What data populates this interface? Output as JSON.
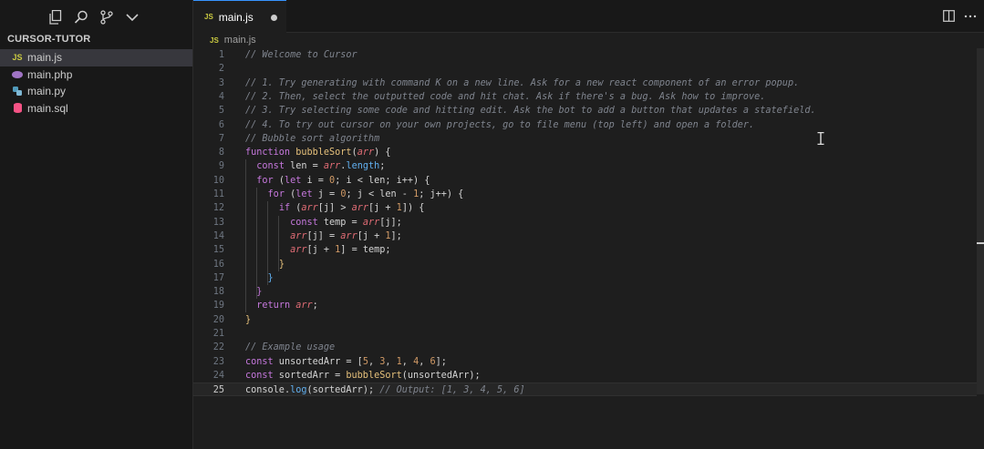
{
  "sidebar": {
    "title": "CURSOR-TUTOR",
    "files": [
      {
        "name": "main.js",
        "badge": "JS",
        "color": "#cbcb41"
      },
      {
        "name": "main.php",
        "badge": "php",
        "color": "#a074c4"
      },
      {
        "name": "main.py",
        "badge": "py",
        "color": "#519aba"
      },
      {
        "name": "main.sql",
        "badge": "sql",
        "color": "#f55385"
      }
    ],
    "icons": [
      "files-icon",
      "search-icon",
      "source-control-icon",
      "chevron-down-icon"
    ]
  },
  "tab": {
    "label": "main.js",
    "badge": "JS",
    "modified": true
  },
  "breadcrumb": {
    "badge": "JS",
    "label": "main.js"
  },
  "editor": {
    "current_line": 25,
    "lines": [
      {
        "n": "1"
      },
      {
        "n": "2"
      },
      {
        "n": "3"
      },
      {
        "n": "4"
      },
      {
        "n": "5"
      },
      {
        "n": "6"
      },
      {
        "n": "7"
      },
      {
        "n": "8"
      },
      {
        "n": "9"
      },
      {
        "n": "10"
      },
      {
        "n": "11"
      },
      {
        "n": "12"
      },
      {
        "n": "13"
      },
      {
        "n": "14"
      },
      {
        "n": "15"
      },
      {
        "n": "16"
      },
      {
        "n": "17"
      },
      {
        "n": "18"
      },
      {
        "n": "19"
      },
      {
        "n": "20"
      },
      {
        "n": "21"
      },
      {
        "n": "22"
      },
      {
        "n": "23"
      },
      {
        "n": "24"
      },
      {
        "n": "25"
      }
    ],
    "tokens": {
      "l1": "// Welcome to Cursor",
      "l3": "// 1. Try generating with command K on a new line. Ask for a new react component of an error popup.",
      "l4": "// 2. Then, select the outputted code and hit chat. Ask if there's a bug. Ask how to improve.",
      "l5": "// 3. Try selecting some code and hitting edit. Ask the bot to add a button that updates a statefield.",
      "l6": "// 4. To try out cursor on your own projects, go to file menu (top left) and open a folder.",
      "l7": "// Bubble sort algorithm",
      "function": "function",
      "bubbleSort": "bubbleSort",
      "arr": "arr",
      "const": "const",
      "for": "for",
      "let": "let",
      "if": "if",
      "return": "return",
      "length": "length",
      "console": "console",
      "log": "log",
      "l8_rest": ") {",
      "l9_a": " len = ",
      "l9_b": ";",
      "l10_a": " (",
      "l10_b": " i = ",
      "l10_c": "0",
      "l10_d": "; i < len; i++) {",
      "l11_b": " j = ",
      "l11_d": "; j < len - ",
      "l11_e": "1",
      "l11_f": "; j++) {",
      "l12_a": " (",
      "l12_b": "[j] > ",
      "l12_c": "[j + ",
      "l12_d": "]) {",
      "l13_a": " temp = ",
      "l13_b": "[j];",
      "l14_a": "[j] = ",
      "l14_b": "[j + ",
      "l14_c": "];",
      "l15_a": "[j + ",
      "l15_b": "] = temp;",
      "brace_close": "}",
      "l19_a": " ",
      "l19_b": ";",
      "l22": "// Example usage",
      "l23_a": " unsortedArr = [",
      "n5": "5",
      "n3": "3",
      "n1": "1",
      "n4": "4",
      "n6": "6",
      "comma": ", ",
      "l23_end": "];",
      "l24_a": " sortedArr = ",
      "l24_b": "(unsortedArr);",
      "dot": ".",
      "l25_a": "(sortedArr); ",
      "l25_cm": "// Output: [1, 3, 4, 5, 6]",
      "paren": "("
    }
  }
}
